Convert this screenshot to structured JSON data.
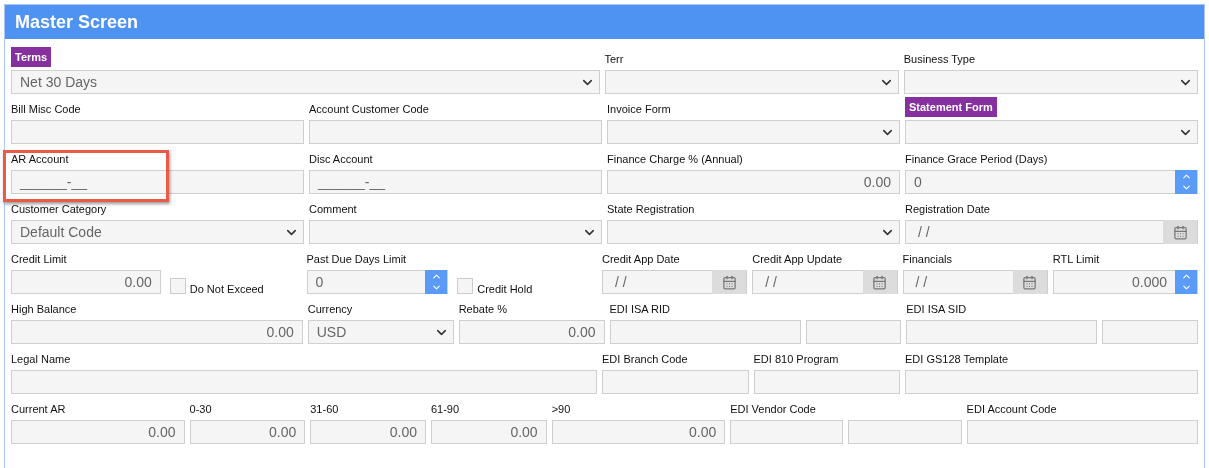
{
  "title": "Master Screen",
  "rows": [
    {
      "fields": [
        {
          "kind": "select",
          "label": "Terms",
          "value": "Net 30 Days",
          "highlighted": true,
          "callout": false
        },
        {
          "kind": "select",
          "label": "Terr",
          "highlighted": false,
          "callout": false
        },
        {
          "kind": "select",
          "label": "Business Type",
          "highlighted": false,
          "callout": false
        }
      ]
    },
    {
      "fields": [
        {
          "kind": "text",
          "label": "Bill Misc Code",
          "highlighted": false,
          "callout": false
        },
        {
          "kind": "text",
          "label": "Account Customer Code",
          "highlighted": false,
          "callout": false
        },
        {
          "kind": "select",
          "label": "Invoice Form",
          "highlighted": false,
          "callout": false
        },
        {
          "kind": "select",
          "label": "Statement Form",
          "highlighted": true,
          "callout": false
        }
      ]
    },
    {
      "fields": [
        {
          "kind": "text",
          "label": "AR Account",
          "value": "______-__",
          "highlighted": false,
          "callout": true
        },
        {
          "kind": "text",
          "label": "Disc Account",
          "value": "______-__",
          "highlighted": false,
          "callout": false
        },
        {
          "kind": "number",
          "label": "Finance Charge % (Annual)",
          "value": "0.00",
          "highlighted": false,
          "callout": false
        },
        {
          "kind": "spinner",
          "label": "Finance Grace Period (Days)",
          "value": "0",
          "highlighted": false,
          "callout": false
        }
      ]
    },
    {
      "fields": [
        {
          "kind": "select",
          "label": "Customer Category",
          "value": "Default Code",
          "highlighted": false,
          "callout": false
        },
        {
          "kind": "select",
          "label": "Comment",
          "highlighted": false,
          "callout": false
        },
        {
          "kind": "select",
          "label": "State Registration",
          "highlighted": false,
          "callout": false
        },
        {
          "kind": "date",
          "label": "Registration Date",
          "value": "/ /",
          "highlighted": false,
          "callout": false
        }
      ]
    },
    {
      "fields": [
        {
          "kind": "number-check",
          "label": "Credit Limit",
          "value": "0.00",
          "checkbox": {
            "label": "Do Not Exceed",
            "checked": false
          },
          "highlighted": false,
          "callout": false
        },
        {
          "kind": "spinner-check",
          "label": "Past Due Days Limit",
          "value": "0",
          "checkbox": {
            "label": "Credit Hold",
            "checked": false
          },
          "highlighted": false,
          "callout": false
        },
        {
          "kind": "date",
          "label": "Credit App Date",
          "value": "/ /",
          "highlighted": false,
          "callout": false
        },
        {
          "kind": "date",
          "label": "Credit App Update",
          "value": "/ /",
          "highlighted": false,
          "callout": false
        },
        {
          "kind": "date",
          "label": "Financials",
          "value": "/ /",
          "highlighted": false,
          "callout": false
        },
        {
          "kind": "number-spinner",
          "label": "RTL Limit",
          "value": "0.000",
          "highlighted": false,
          "callout": false
        }
      ]
    },
    {
      "fields": [
        {
          "kind": "number",
          "label": "High Balance",
          "value": "0.00",
          "highlighted": false,
          "callout": false
        },
        {
          "kind": "select",
          "label": "Currency",
          "value": "USD",
          "highlighted": false,
          "callout": false
        },
        {
          "kind": "number",
          "label": "Rebate %",
          "value": "0.00",
          "highlighted": false,
          "callout": false
        },
        {
          "kind": "split",
          "label": "EDI ISA RID",
          "highlighted": false,
          "callout": false
        },
        {
          "kind": "split",
          "label": "EDI ISA SID",
          "highlighted": false,
          "callout": false
        }
      ]
    },
    {
      "fields": [
        {
          "kind": "text",
          "label": "Legal Name",
          "highlighted": false,
          "callout": false
        },
        {
          "kind": "text",
          "label": "EDI Branch Code",
          "highlighted": false,
          "callout": false
        },
        {
          "kind": "text",
          "label": "EDI 810 Program",
          "highlighted": false,
          "callout": false
        },
        {
          "kind": "text",
          "label": "EDI GS128 Template",
          "highlighted": false,
          "callout": false
        }
      ]
    },
    {
      "fields": [
        {
          "kind": "number",
          "label": "Current AR",
          "value": "0.00",
          "highlighted": false,
          "callout": false
        },
        {
          "kind": "number",
          "label": "0-30",
          "value": "0.00",
          "highlighted": false,
          "callout": false
        },
        {
          "kind": "number",
          "label": "31-60",
          "value": "0.00",
          "highlighted": false,
          "callout": false
        },
        {
          "kind": "number",
          "label": "61-90",
          "value": "0.00",
          "highlighted": false,
          "callout": false
        },
        {
          "kind": "number",
          "label": ">90",
          "value": "0.00",
          "highlighted": false,
          "callout": false
        },
        {
          "kind": "pair",
          "label": "EDI Vendor Code",
          "highlighted": false,
          "callout": false
        },
        {
          "kind": "text",
          "label": "EDI Account Code",
          "highlighted": false,
          "callout": false
        }
      ]
    }
  ]
}
